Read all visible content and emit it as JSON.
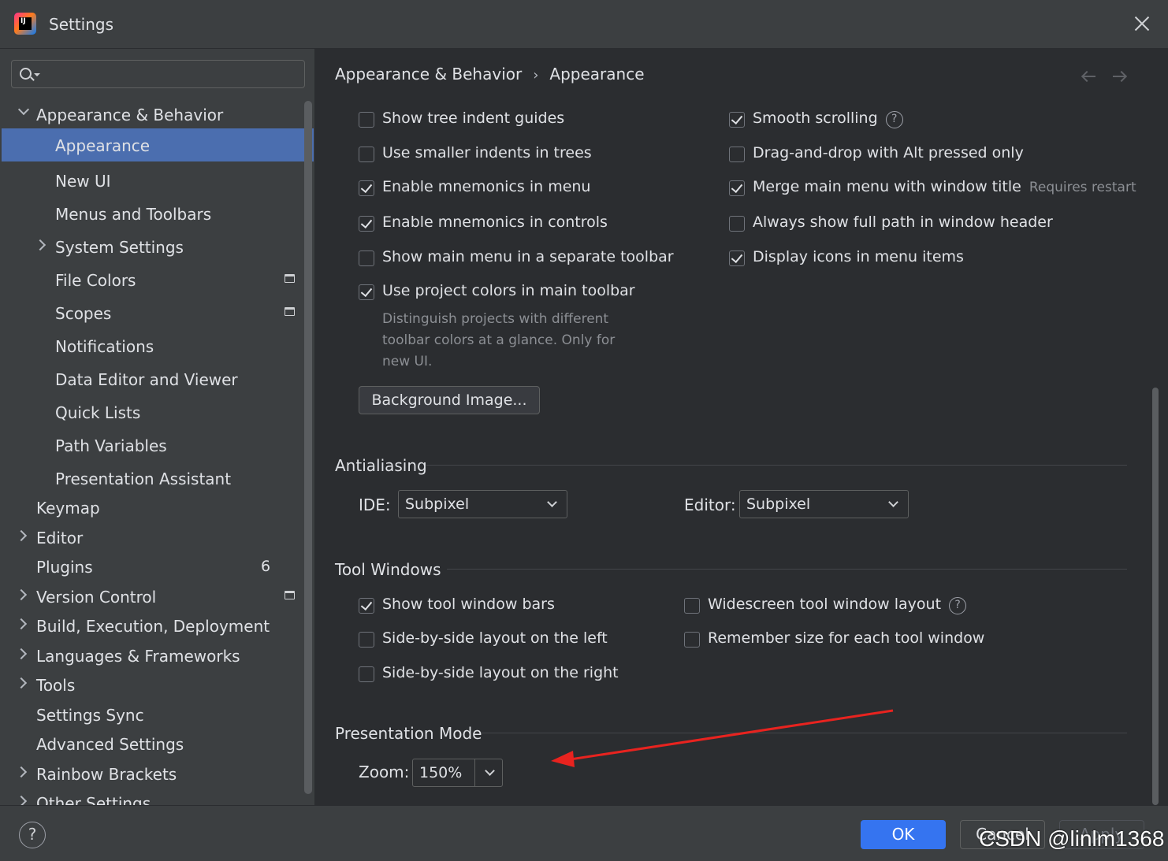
{
  "window": {
    "title": "Settings",
    "logo": "intellij-logo-icon",
    "logo_letters": "IJ"
  },
  "search": {
    "value": "",
    "placeholder": ""
  },
  "sidebar": {
    "items": [
      {
        "label": "Appearance & Behavior",
        "expanded": true
      },
      {
        "label": "Appearance",
        "selected": true
      },
      {
        "label": "New UI"
      },
      {
        "label": "Menus and Toolbars"
      },
      {
        "label": "System Settings",
        "expandable": true
      },
      {
        "label": "File Colors",
        "icon": "project-level-icon"
      },
      {
        "label": "Scopes",
        "icon": "project-level-icon"
      },
      {
        "label": "Notifications"
      },
      {
        "label": "Data Editor and Viewer"
      },
      {
        "label": "Quick Lists"
      },
      {
        "label": "Path Variables"
      },
      {
        "label": "Presentation Assistant"
      },
      {
        "label": "Keymap"
      },
      {
        "label": "Editor",
        "expandable": true
      },
      {
        "label": "Plugins",
        "badge": "6"
      },
      {
        "label": "Version Control",
        "expandable": true,
        "icon": "project-level-icon"
      },
      {
        "label": "Build, Execution, Deployment",
        "expandable": true
      },
      {
        "label": "Languages & Frameworks",
        "expandable": true
      },
      {
        "label": "Tools",
        "expandable": true
      },
      {
        "label": "Settings Sync"
      },
      {
        "label": "Advanced Settings"
      },
      {
        "label": "Rainbow Brackets",
        "expandable": true
      },
      {
        "label": "Other Settings",
        "expandable": true
      }
    ]
  },
  "breadcrumb": {
    "parent": "Appearance & Behavior",
    "separator": "›",
    "current": "Appearance"
  },
  "options": {
    "left": [
      {
        "label": "Show tree indent guides",
        "checked": false
      },
      {
        "label": "Use smaller indents in trees",
        "checked": false
      },
      {
        "label": "Enable mnemonics in menu",
        "checked": true
      },
      {
        "label": "Enable mnemonics in controls",
        "checked": true
      },
      {
        "label": "Show main menu in a separate toolbar",
        "checked": false
      },
      {
        "label": "Use project colors in main toolbar",
        "checked": true
      }
    ],
    "right": [
      {
        "label": "Smooth scrolling",
        "checked": true
      },
      {
        "label": "Drag-and-drop with Alt pressed only",
        "checked": false
      },
      {
        "label": "Merge main menu with window title",
        "checked": true,
        "hint": "Requires restart"
      },
      {
        "label": "Always show full path in window header",
        "checked": false
      },
      {
        "label": "Display icons in menu items",
        "checked": true
      }
    ],
    "project_colors_desc": "Distinguish projects with different toolbar colors at a glance. Only for new UI.",
    "background_image_button": "Background Image..."
  },
  "antialiasing": {
    "title": "Antialiasing",
    "ide_label": "IDE:",
    "ide_value": "Subpixel",
    "editor_label": "Editor:",
    "editor_value": "Subpixel"
  },
  "tool_windows": {
    "title": "Tool Windows",
    "left": [
      {
        "label": "Show tool window bars",
        "checked": true
      },
      {
        "label": "Side-by-side layout on the left",
        "checked": false
      },
      {
        "label": "Side-by-side layout on the right",
        "checked": false
      }
    ],
    "right": [
      {
        "label": "Widescreen tool window layout",
        "checked": false
      },
      {
        "label": "Remember size for each tool window",
        "checked": false
      }
    ]
  },
  "presentation_mode": {
    "title": "Presentation Mode",
    "zoom_label": "Zoom:",
    "zoom_value": "150%"
  },
  "footer": {
    "help": "?",
    "ok": "OK",
    "cancel": "Cancel",
    "apply": "Apply"
  },
  "watermark": "CSDN @linlm1368",
  "colors": {
    "accent": "#3574f0",
    "selection": "#4b6eaf",
    "annotation_arrow": "#e8231f"
  }
}
